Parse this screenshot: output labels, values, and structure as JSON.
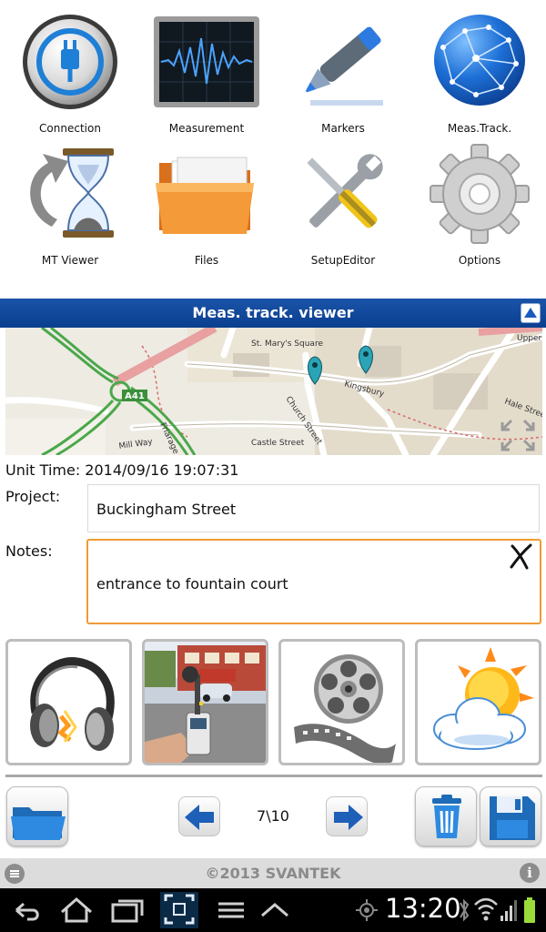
{
  "menu": {
    "items": [
      {
        "label": "Connection",
        "icon": "plug-icon"
      },
      {
        "label": "Measurement",
        "icon": "waveform-icon"
      },
      {
        "label": "Markers",
        "icon": "marker-pen-icon"
      },
      {
        "label": "Meas.Track.",
        "icon": "globe-network-icon"
      },
      {
        "label": "MT Viewer",
        "icon": "hourglass-icon"
      },
      {
        "label": "Files",
        "icon": "folder-icon"
      },
      {
        "label": "SetupEditor",
        "icon": "tools-icon"
      },
      {
        "label": "Options",
        "icon": "gear-icon"
      }
    ]
  },
  "header": {
    "title": "Meas. track. viewer",
    "collapse_icon": "triangle-up-icon"
  },
  "map": {
    "labels": {
      "road": "A41",
      "st_marys": "St. Mary's Square",
      "kingsbury": "Kingsbury",
      "church": "Church Street",
      "mill": "Mill Way",
      "castle": "Castle Street",
      "hale": "Hale Street",
      "upper": "Upper",
      "friarage": "Friarage"
    },
    "marker_count": 2
  },
  "details": {
    "unit_time": "Unit Time: 2014/09/16 19:07:31",
    "project_label": "Project:",
    "project_value": "Buckingham  Street",
    "notes_label": "Notes:",
    "notes_value": "entrance to fountain  court"
  },
  "media": {
    "items": [
      {
        "kind": "audio",
        "icon": "headphones-icon"
      },
      {
        "kind": "photo",
        "icon": "photo-thumbnail"
      },
      {
        "kind": "video",
        "icon": "film-reel-icon"
      },
      {
        "kind": "weather",
        "icon": "sun-cloud-icon"
      }
    ]
  },
  "toolbar": {
    "page_indicator": "7\\10"
  },
  "footer": {
    "copyright": "©2013 SVANTEK"
  },
  "system_bar": {
    "time": "13:20"
  },
  "colors": {
    "header_blue": "#0b3f8f",
    "notes_border": "#f29a35",
    "footer_bg": "#dcdcdc"
  }
}
